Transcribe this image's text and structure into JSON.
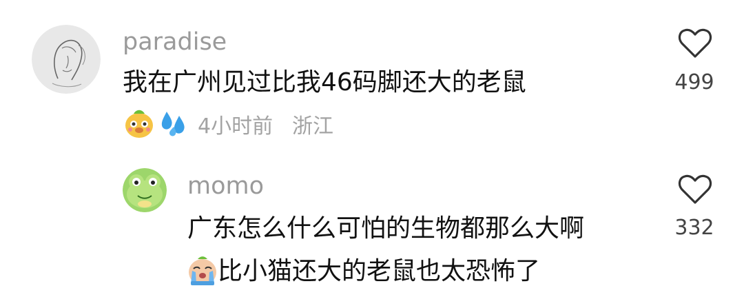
{
  "comments": [
    {
      "username": "paradise",
      "text": "我在广州见过比我46码脚还大的老鼠",
      "time": "4小时前",
      "location": "浙江",
      "likes": "499",
      "avatar_icon": "sketch-portrait-avatar",
      "reaction_icons": [
        "doge-emoji-icon",
        "sweat-drops-emoji-icon"
      ]
    },
    {
      "username": "momo",
      "text_line1": "广东怎么什么可怕的生物都那么大啊",
      "text_line2": "比小猫还大的老鼠也太恐怖了",
      "likes": "332",
      "avatar_icon": "green-frog-avatar",
      "inline_icon": "crying-emoji-icon"
    }
  ],
  "colors": {
    "username": "#9a9a9a",
    "text": "#111111",
    "meta": "#a3a3a3",
    "heart": "#333333",
    "background": "#ffffff"
  }
}
